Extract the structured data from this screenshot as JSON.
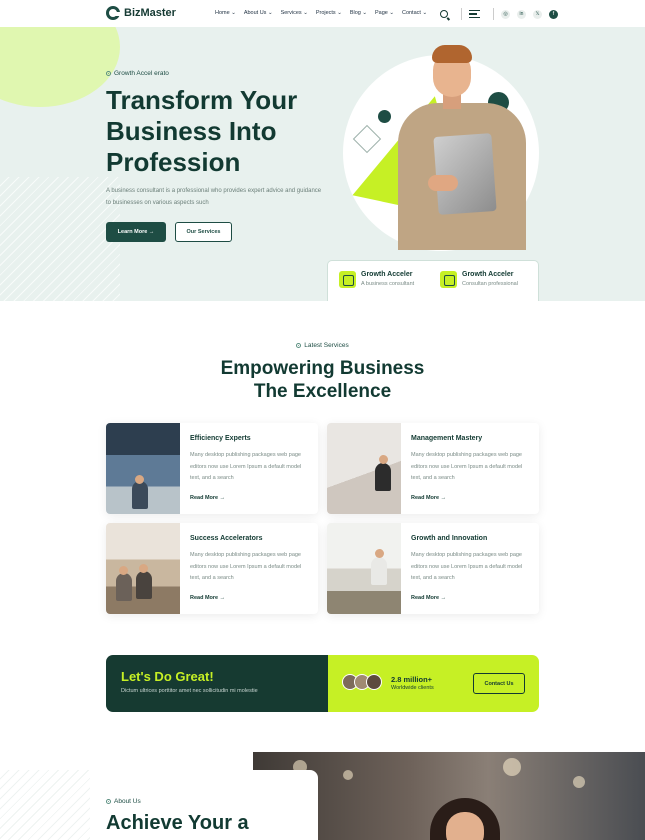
{
  "brand": {
    "name": "BizMaster"
  },
  "nav": {
    "items": [
      "Home ⌄",
      "About Us ⌄",
      "Services ⌄",
      "Projects ⌄",
      "Blog ⌄",
      "Page ⌄",
      "Contact ⌄"
    ]
  },
  "social": [
    "◎",
    "in",
    "𝕏",
    "f"
  ],
  "hero": {
    "eyebrow": "Growth Accel erato",
    "title": "Transform Your Business Into Profession",
    "desc": "A business consultant is a professional who provides expert advice and guidance to businesses on various aspects such",
    "btn_primary": "Learn More →",
    "btn_outline": "Our Services",
    "stats": [
      {
        "title": "Growth Acceler",
        "sub": "A business consultant"
      },
      {
        "title": "Growth Acceler",
        "sub": "Consultan professional"
      }
    ]
  },
  "services": {
    "eyebrow": "Latest Services",
    "title_line1": "Empowering Business",
    "title_line2": "The Excellence",
    "cards": [
      {
        "title": "Efficiency Experts",
        "desc": "Many desktop publishing packages web page editors now use Lorem Ipsum a default model text, and a search",
        "link": "Read More →"
      },
      {
        "title": "Management Mastery",
        "desc": "Many desktop publishing packages web page editors now use Lorem Ipsum a default model text, and a search",
        "link": "Read More →"
      },
      {
        "title": "Success Accelerators",
        "desc": "Many desktop publishing packages web page editors now use Lorem Ipsum a default model text, and a search",
        "link": "Read More →"
      },
      {
        "title": "Growth and Innovation",
        "desc": "Many desktop publishing packages web page editors now use Lorem Ipsum a default model text, and a search",
        "link": "Read More →"
      }
    ]
  },
  "cta": {
    "title": "Let's Do Great!",
    "sub": "Dictum ultrices porttitor amet nec sollicitudin mi molestie",
    "count": "2.8 million+",
    "count_sub": "Worldwide clients",
    "button": "Contact Us"
  },
  "about": {
    "eyebrow": "About Us",
    "title": "Achieve Your a"
  },
  "colors": {
    "brand": "#1e4d44",
    "accent": "#c6f025",
    "dark": "#163a31",
    "hero_bg": "#e8f1ee"
  }
}
